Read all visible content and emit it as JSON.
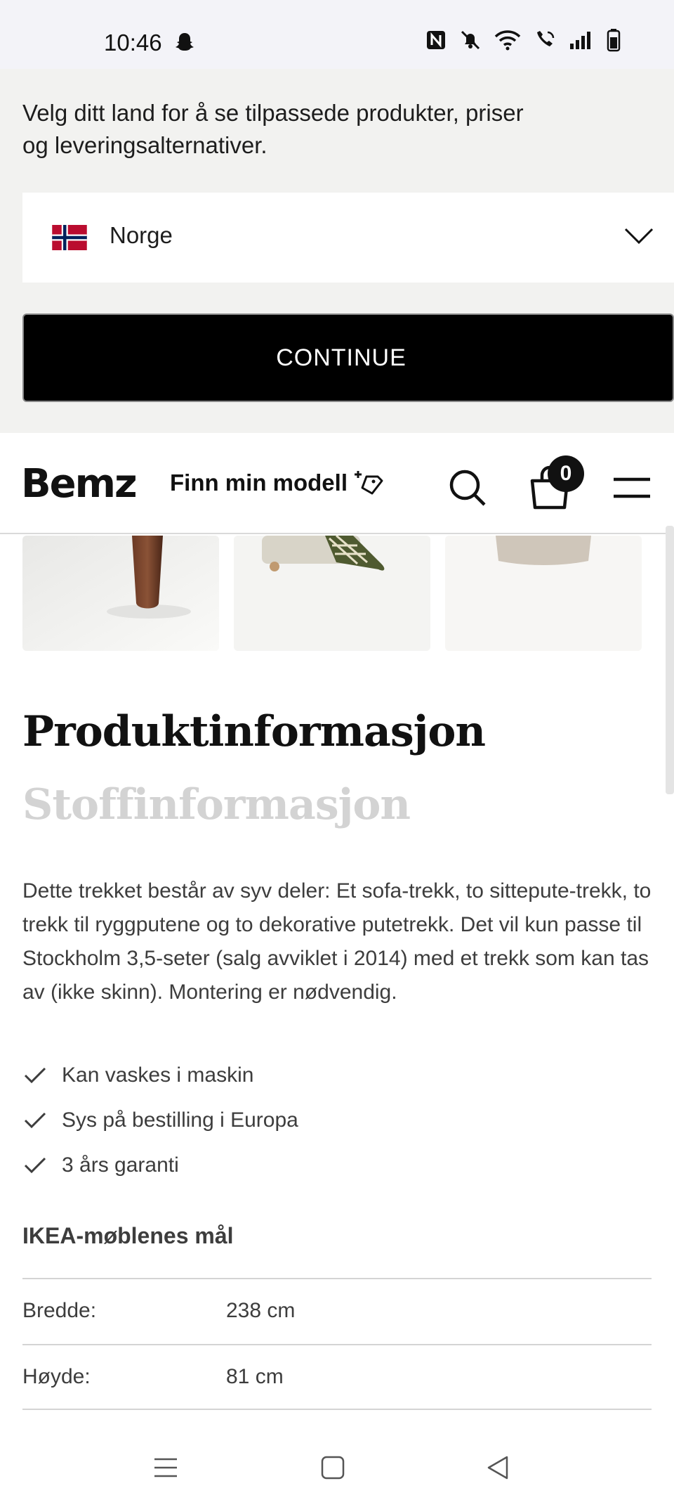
{
  "status_bar": {
    "time": "10:46",
    "icons": [
      "snapchat-icon",
      "nfc-icon",
      "mute-icon",
      "wifi-icon",
      "wifi-call-icon",
      "signal-icon",
      "battery-icon"
    ]
  },
  "country_banner": {
    "message": "Velg ditt land for å se tilpassede produkter, priser og leveringsalternativer.",
    "selected_country": "Norge",
    "continue_label": "CONTINUE"
  },
  "header": {
    "logo": "Bemz",
    "finn_label": "Finn min modell",
    "cart_count": "0"
  },
  "thumbnails": [
    "sofa-leg-image",
    "sofa-with-blanket-image",
    "cushion-image"
  ],
  "content": {
    "title": "Produktinformasjon",
    "subtitle": "Stoffinformasjon",
    "description": "Dette trekket består av syv deler: Et sofa-trekk, to sittepute-trekk, to trekk til ryggputene og to dekorative putetrekk. Det vil kun passe til Stockholm 3,5-seter (salg avviklet i 2014) med et trekk som kan tas av (ikke skinn). Montering er nødvendig.",
    "features": [
      "Kan vaskes i maskin",
      "Sys på bestilling i Europa",
      "3 års garanti"
    ],
    "dimensions_title": "IKEA-møblenes mål",
    "dimensions": [
      {
        "label": "Bredde:",
        "value": "238 cm"
      },
      {
        "label": "Høyde:",
        "value": "81 cm"
      }
    ]
  },
  "colors": {
    "banner_bg": "#f2f2f0",
    "button_bg": "#000000",
    "muted_heading": "#d3d3d3",
    "text": "#3d3d3d"
  }
}
